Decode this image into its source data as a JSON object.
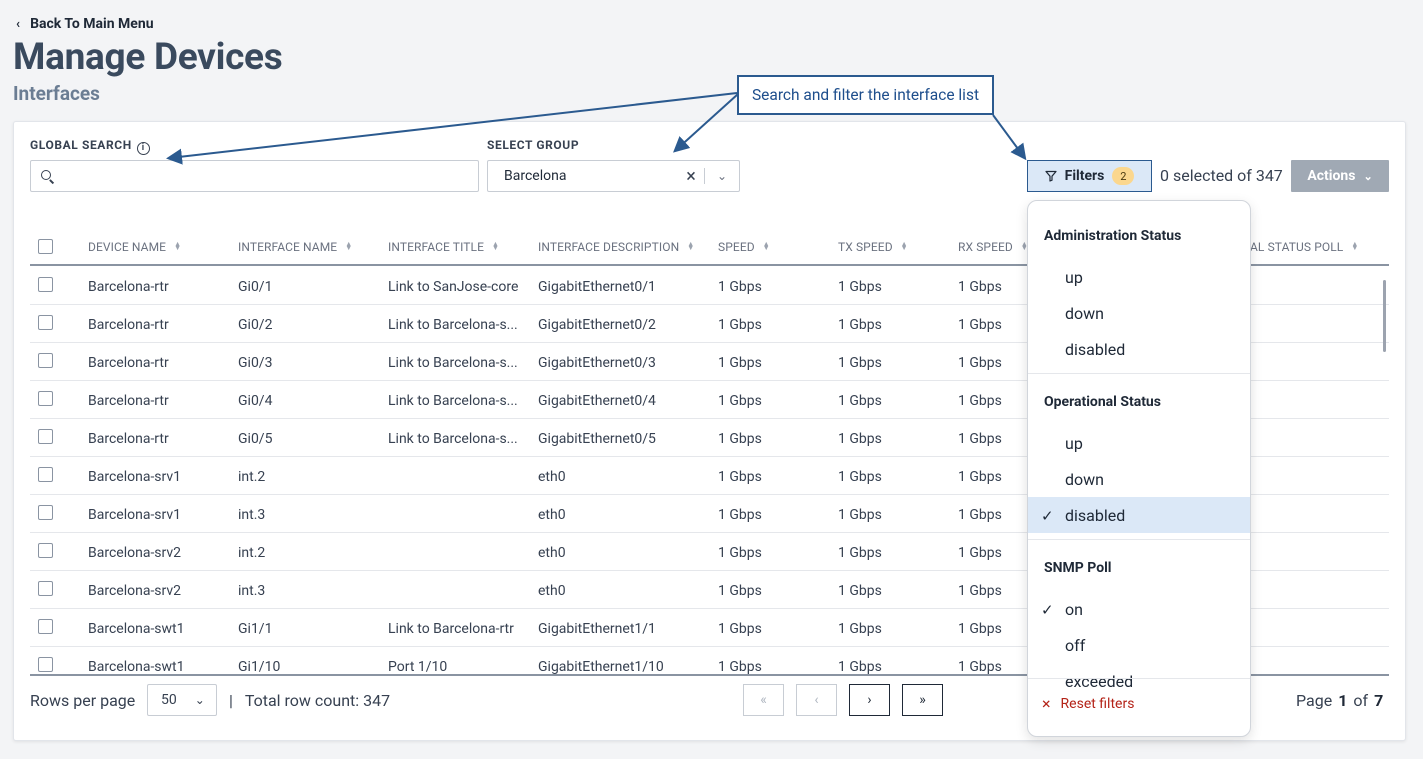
{
  "nav": {
    "back_label": "Back To Main Menu"
  },
  "page": {
    "title": "Manage Devices",
    "subtitle": "Interfaces"
  },
  "annotation": {
    "callout_text": "Search and filter the interface list"
  },
  "toolbar": {
    "global_search_label": "GLOBAL SEARCH",
    "global_search_value": "",
    "select_group_label": "SELECT GROUP",
    "select_group_value": "Barcelona",
    "filters_label": "Filters",
    "filters_count": "2",
    "selection_text": "0 selected of 347",
    "actions_label": "Actions"
  },
  "table": {
    "columns": [
      "DEVICE NAME",
      "INTERFACE NAME",
      "INTERFACE TITLE",
      "INTERFACE DESCRIPTION",
      "SPEED",
      "TX SPEED",
      "RX SPEED",
      "AL STATUS POLL"
    ],
    "rows": [
      [
        "Barcelona-rtr",
        "Gi0/1",
        "Link to SanJose-core",
        "GigabitEthernet0/1",
        "1 Gbps",
        "1 Gbps",
        "1 Gbps"
      ],
      [
        "Barcelona-rtr",
        "Gi0/2",
        "Link to Barcelona-s...",
        "GigabitEthernet0/2",
        "1 Gbps",
        "1 Gbps",
        "1 Gbps"
      ],
      [
        "Barcelona-rtr",
        "Gi0/3",
        "Link to Barcelona-s...",
        "GigabitEthernet0/3",
        "1 Gbps",
        "1 Gbps",
        "1 Gbps"
      ],
      [
        "Barcelona-rtr",
        "Gi0/4",
        "Link to Barcelona-s...",
        "GigabitEthernet0/4",
        "1 Gbps",
        "1 Gbps",
        "1 Gbps"
      ],
      [
        "Barcelona-rtr",
        "Gi0/5",
        "Link to Barcelona-s...",
        "GigabitEthernet0/5",
        "1 Gbps",
        "1 Gbps",
        "1 Gbps"
      ],
      [
        "Barcelona-srv1",
        "int.2",
        "",
        "eth0",
        "1 Gbps",
        "1 Gbps",
        "1 Gbps"
      ],
      [
        "Barcelona-srv1",
        "int.3",
        "",
        "eth0",
        "1 Gbps",
        "1 Gbps",
        "1 Gbps"
      ],
      [
        "Barcelona-srv2",
        "int.2",
        "",
        "eth0",
        "1 Gbps",
        "1 Gbps",
        "1 Gbps"
      ],
      [
        "Barcelona-srv2",
        "int.3",
        "",
        "eth0",
        "1 Gbps",
        "1 Gbps",
        "1 Gbps"
      ],
      [
        "Barcelona-swt1",
        "Gi1/1",
        "Link to Barcelona-rtr",
        "GigabitEthernet1/1",
        "1 Gbps",
        "1 Gbps",
        "1 Gbps"
      ],
      [
        "Barcelona-swt1",
        "Gi1/10",
        "Port 1/10",
        "GigabitEthernet1/10",
        "1 Gbps",
        "1 Gbps",
        "1 Gbps"
      ]
    ]
  },
  "pagination": {
    "rows_per_page_label": "Rows per page",
    "rows_per_page_value": "50",
    "total_text": "Total row count: 347",
    "page_label": "Page",
    "current_page": "1",
    "of_label": "of",
    "total_pages": "7"
  },
  "filter_popup": {
    "sections": [
      {
        "title": "Administration Status",
        "options": [
          {
            "label": "up",
            "checked": false
          },
          {
            "label": "down",
            "checked": false
          },
          {
            "label": "disabled",
            "checked": false
          }
        ]
      },
      {
        "title": "Operational Status",
        "options": [
          {
            "label": "up",
            "checked": false
          },
          {
            "label": "down",
            "checked": false
          },
          {
            "label": "disabled",
            "checked": true
          }
        ]
      },
      {
        "title": "SNMP Poll",
        "options": [
          {
            "label": "on",
            "checked": true
          },
          {
            "label": "off",
            "checked": false
          },
          {
            "label": "exceeded",
            "checked": false
          }
        ]
      }
    ],
    "reset_label": "Reset filters"
  },
  "colors": {
    "accent": "#2b5a8f",
    "selected_bg": "#dbe8f7",
    "badge": "#fbd78e",
    "danger": "#b42318"
  }
}
